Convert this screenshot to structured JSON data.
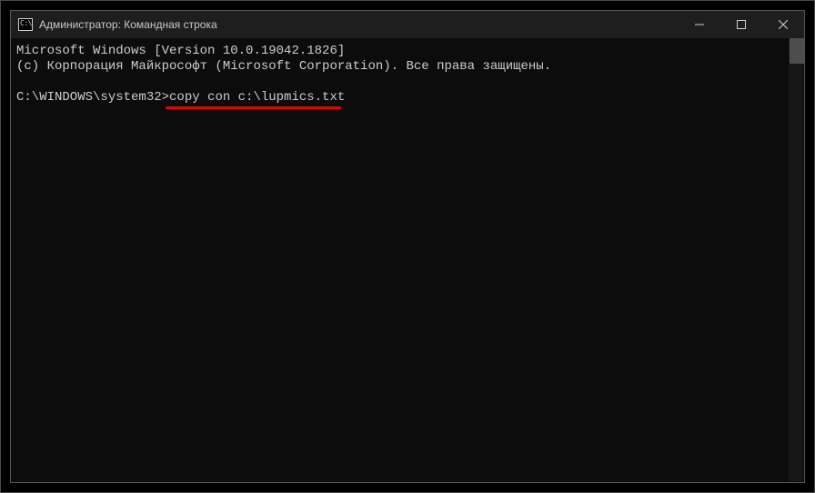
{
  "titlebar": {
    "icon_glyph": "C:\\",
    "title": "Администратор: Командная строка"
  },
  "console": {
    "line1": "Microsoft Windows [Version 10.0.19042.1826]",
    "line2": "(c) Корпорация Майкрософт (Microsoft Corporation). Все права защищены.",
    "blank": "",
    "prompt": "C:\\WINDOWS\\system32>",
    "command": "copy con c:\\lupmics.txt"
  },
  "annotation": {
    "underline_color": "#e60000"
  }
}
